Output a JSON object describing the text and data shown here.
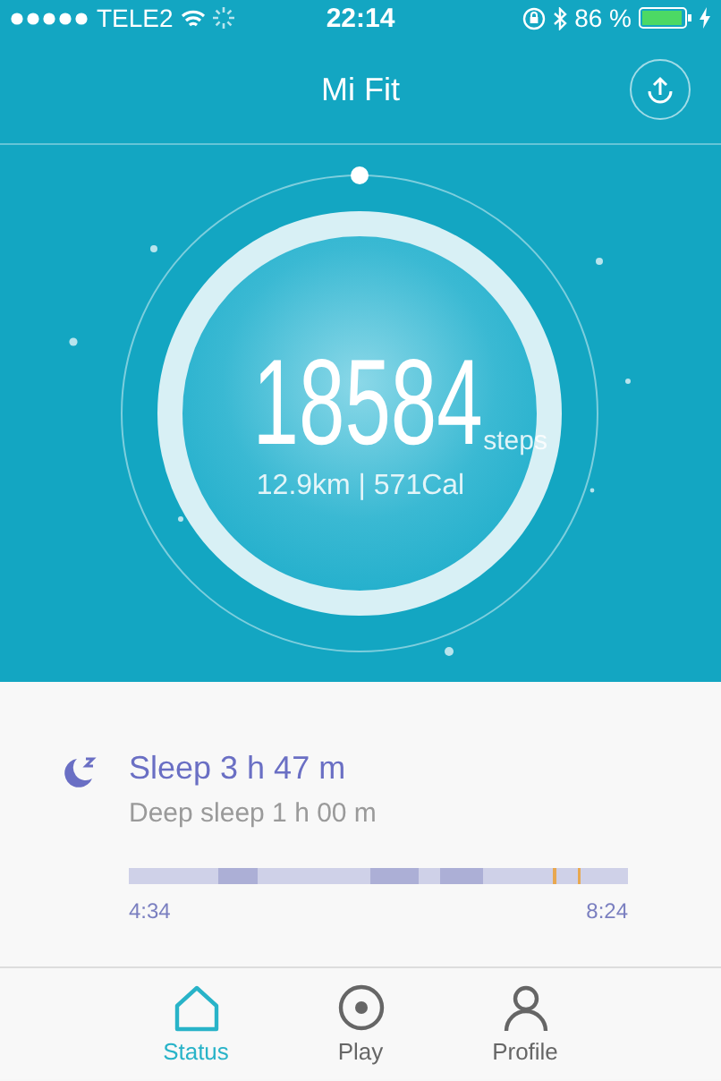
{
  "status_bar": {
    "carrier": "TELE2",
    "time": "22:14",
    "battery": "86 %"
  },
  "header": {
    "title": "Mi Fit"
  },
  "steps": {
    "count": "18584",
    "unit": "steps",
    "summary": "12.9km | 571Cal"
  },
  "sleep": {
    "title": "Sleep 3 h 47 m",
    "detail": "Deep sleep 1 h 00 m",
    "start": "4:34",
    "end": "8:24"
  },
  "tabs": [
    {
      "label": "Status",
      "kind": "home",
      "selected": true
    },
    {
      "label": "Play",
      "kind": "play",
      "selected": false
    },
    {
      "label": "Profile",
      "kind": "person",
      "selected": false
    }
  ]
}
